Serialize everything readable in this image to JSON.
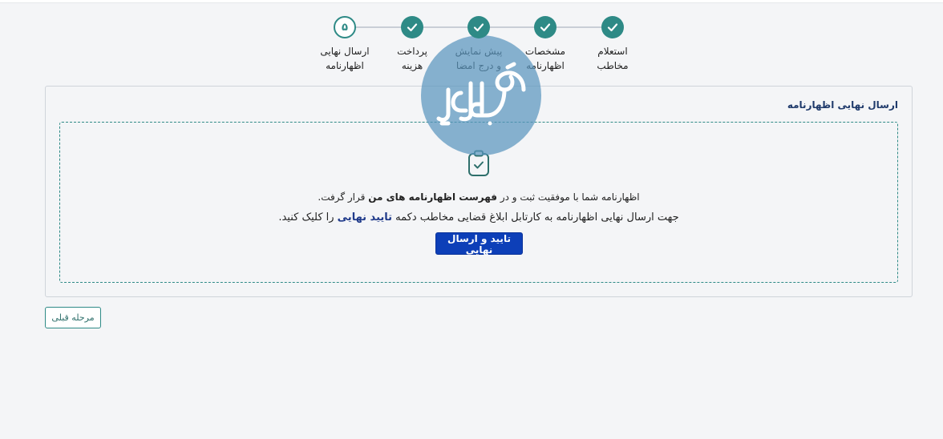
{
  "stepper": {
    "steps": [
      {
        "label": "استعلام\nمخاطب",
        "state": "done",
        "icon": "check-icon"
      },
      {
        "label": "مشخصات\nاظهارنامه",
        "state": "done",
        "icon": "check-icon"
      },
      {
        "label": "پیش نمایش\nو درج امضا",
        "state": "done",
        "icon": "check-icon"
      },
      {
        "label": "پرداخت\nهزینه",
        "state": "done",
        "icon": "check-icon"
      },
      {
        "label": "ارسال نهایی\nاظهارنامه",
        "state": "current",
        "number": "۵"
      }
    ]
  },
  "card": {
    "title": "ارسال نهایی اظهارنامه",
    "message1": {
      "before": "اظهارنامه شما با موفقیت ثبت و در ",
      "bold": "فهرست اظهارنامه های من",
      "after": " قرار گرفت."
    },
    "message2": {
      "before": "جهت ارسال نهایی اظهارنامه به کارتابل ابلاغ قضایی مخاطب دکمه ",
      "bold": "تایید نهایی",
      "after": " را کلیک کنید."
    },
    "confirm_button": "تایید و ارسال نهایی"
  },
  "prev_button": "مرحله قبلی",
  "watermark": "وکلاپرس",
  "colors": {
    "accent": "#2e8a86",
    "primary": "#0d3fb8",
    "title": "#1f3a6b",
    "background": "#f4f5f7"
  }
}
